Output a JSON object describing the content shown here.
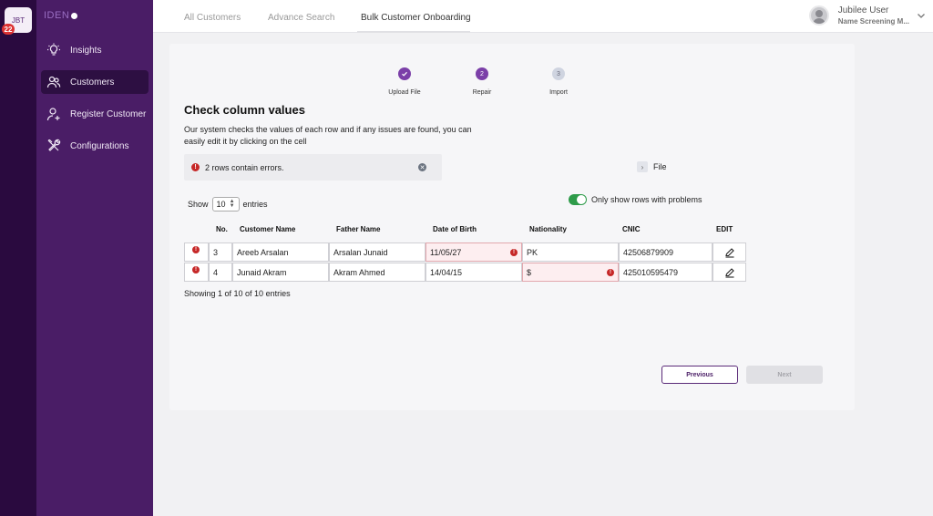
{
  "app": {
    "badge_label": "JBT",
    "notification_count": "22",
    "brand": "IDEN"
  },
  "sidebar": {
    "items": [
      {
        "label": "Insights",
        "icon": "lightbulb-icon"
      },
      {
        "label": "Customers",
        "icon": "users-icon",
        "active": true
      },
      {
        "label": "Register Customer",
        "icon": "add-user-icon"
      },
      {
        "label": "Configurations",
        "icon": "tools-icon"
      }
    ]
  },
  "header": {
    "tabs": [
      {
        "label": "All Customers"
      },
      {
        "label": "Advance Search"
      },
      {
        "label": "Bulk Customer Onboarding",
        "active": true
      }
    ],
    "user": {
      "name": "Jubilee User",
      "role": "Name Screening M..."
    }
  },
  "stepper": {
    "steps": [
      {
        "number": "1",
        "label": "Upload File",
        "state": "done"
      },
      {
        "number": "2",
        "label": "Repair",
        "state": "active"
      },
      {
        "number": "3",
        "label": "Import",
        "state": "pending"
      }
    ]
  },
  "main": {
    "title": "Check column values",
    "description": "Our system checks the values of each row and if any issues are found, you can easily edit it by clicking on the cell",
    "alert": "2 rows contain errors.",
    "file_label": "File",
    "show_label": "Show",
    "entries_value": "10",
    "entries_label": "entries",
    "toggle_label": "Only show rows with problems",
    "toggle_on": true,
    "showing_text": "Showing 1 of 10 of 10 entries",
    "previous_label": "Previous",
    "next_label": "Next"
  },
  "table": {
    "headers": {
      "no": "No.",
      "customer_name": "Customer Name",
      "father_name": "Father Name",
      "dob": "Date of Birth",
      "nationality": "Nationality",
      "cnic": "CNIC",
      "edit": "EDIT"
    },
    "rows": [
      {
        "no": "3",
        "customer_name": "Areeb Arsalan",
        "father_name": "Arsalan Junaid",
        "dob": "11/05/27",
        "nationality": "PK",
        "cnic": "42506879909",
        "error_field": "dob"
      },
      {
        "no": "4",
        "customer_name": "Junaid Akram",
        "father_name": "Akram Ahmed",
        "dob": "14/04/15",
        "nationality": "$",
        "cnic": "425010595479",
        "error_field": "nationality"
      }
    ]
  },
  "colors": {
    "sidebar": "#4a1d66",
    "rail": "#2a0a3f",
    "accent": "#7b3fa8",
    "error": "#c62828",
    "toggle_on": "#2e9b4a"
  }
}
